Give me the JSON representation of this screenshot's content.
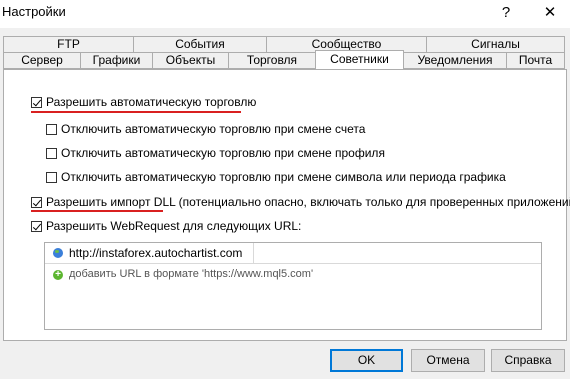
{
  "window": {
    "title": "Настройки",
    "help": "?",
    "close": "✕"
  },
  "tabs_row1": [
    "FTP",
    "События",
    "Сообщество",
    "Сигналы"
  ],
  "tabs_row2": [
    "Сервер",
    "Графики",
    "Объекты",
    "Торговля",
    "Советники",
    "Уведомления",
    "Почта"
  ],
  "selected_tab": "Советники",
  "options": {
    "allow_auto_trading": {
      "label": "Разрешить автоматическую торговлю",
      "checked": true
    },
    "disable_on_account_change": {
      "label": "Отключить автоматическую торговлю при смене счета",
      "checked": false
    },
    "disable_on_profile_change": {
      "label": "Отключить автоматическую торговлю при смене профиля",
      "checked": false
    },
    "disable_on_symbol_change": {
      "label": "Отключить автоматическую торговлю при смене символа или периода графика",
      "checked": false
    },
    "allow_dll_import": {
      "label": "Разрешить импорт DLL (потенциально опасно, включать только для проверенных приложений)",
      "checked": true
    },
    "allow_webrequest": {
      "label": "Разрешить WebRequest для следующих URL:",
      "checked": true
    }
  },
  "url_list": {
    "items": [
      "http://instaforex.autochartist.com"
    ],
    "add_hint": "добавить URL в формате 'https://www.mql5.com'"
  },
  "buttons": {
    "ok": "OK",
    "cancel": "Отмена",
    "help": "Справка"
  },
  "colors": {
    "accent": "#0078d7",
    "annotation_red": "#d92020",
    "dialog_bg": "#f0f0f0"
  }
}
